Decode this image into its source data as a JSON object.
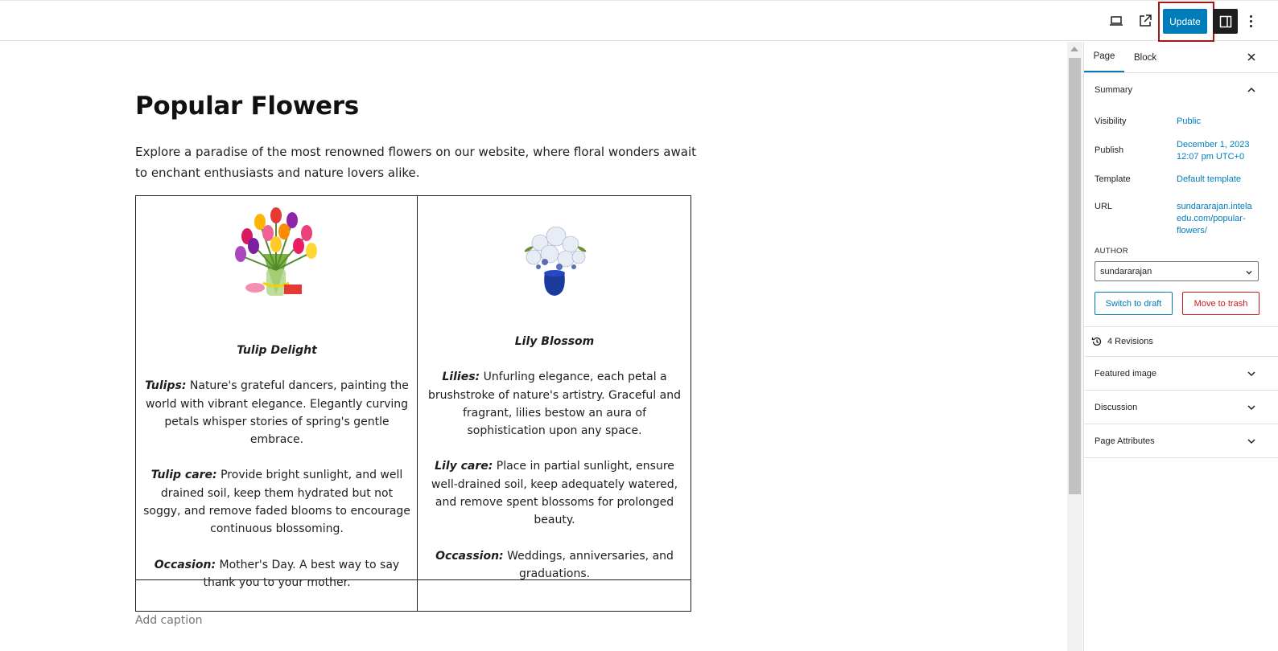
{
  "toolbar": {
    "icons": [
      "laptop-icon",
      "external-link-icon",
      "sidebar-icon",
      "more-vertical-icon"
    ],
    "update_label": "Update",
    "accent": "#007cba",
    "highlight": "#a4161a"
  },
  "editor": {
    "title": "Popular Flowers",
    "intro": "Explore a paradise of the most renowned flowers on our website, where floral wonders await to enchant enthusiasts and nature lovers alike.",
    "cards": [
      {
        "name": "Tulip Delight",
        "desc_label": "Tulips:",
        "desc": " Nature's grateful dancers, painting the world with vibrant elegance. Elegantly curving petals whisper stories of spring's gentle embrace.",
        "care_label": "Tulip care:",
        "care": " Provide bright sunlight, and well drained soil, keep them hydrated but not soggy, and remove faded blooms to encourage continuous blossoming.",
        "occasion_label": "Occasion:",
        "occasion": " Mother's Day. A best way to say thank you to your mother."
      },
      {
        "name": "Lily Blossom",
        "desc_label": "Lilies:",
        "desc": " Unfurling elegance, each petal a brushstroke of nature's artistry. Graceful and fragrant, lilies bestow an aura of sophistication upon any space.",
        "care_label": "Lily care:",
        "care": " Place in partial sunlight, ensure well-drained soil, keep adequately watered, and remove spent blossoms for prolonged beauty.",
        "occasion_label": "Occassion:",
        "occasion": "  Weddings, anniversaries, and graduations."
      }
    ],
    "caption_placeholder": "Add caption"
  },
  "sidebar": {
    "tabs": [
      "Page",
      "Block"
    ],
    "summary": {
      "heading": "Summary",
      "visibility_label": "Visibility",
      "visibility_value": "Public",
      "publish_label": "Publish",
      "publish_line1": "December 1, 2023",
      "publish_line2": "12:07 pm UTC+0",
      "template_label": "Template",
      "template_value": "Default template",
      "url_label": "URL",
      "url_line1": "sundararajan.intela",
      "url_line2": "edu.com/popular-",
      "url_line3": "flowers/",
      "author_label": "AUTHOR",
      "author_value": "sundararajan",
      "switch_draft": "Switch to draft",
      "move_trash": "Move to trash"
    },
    "revisions": "4 Revisions",
    "panels": [
      "Featured image",
      "Discussion",
      "Page Attributes"
    ]
  }
}
